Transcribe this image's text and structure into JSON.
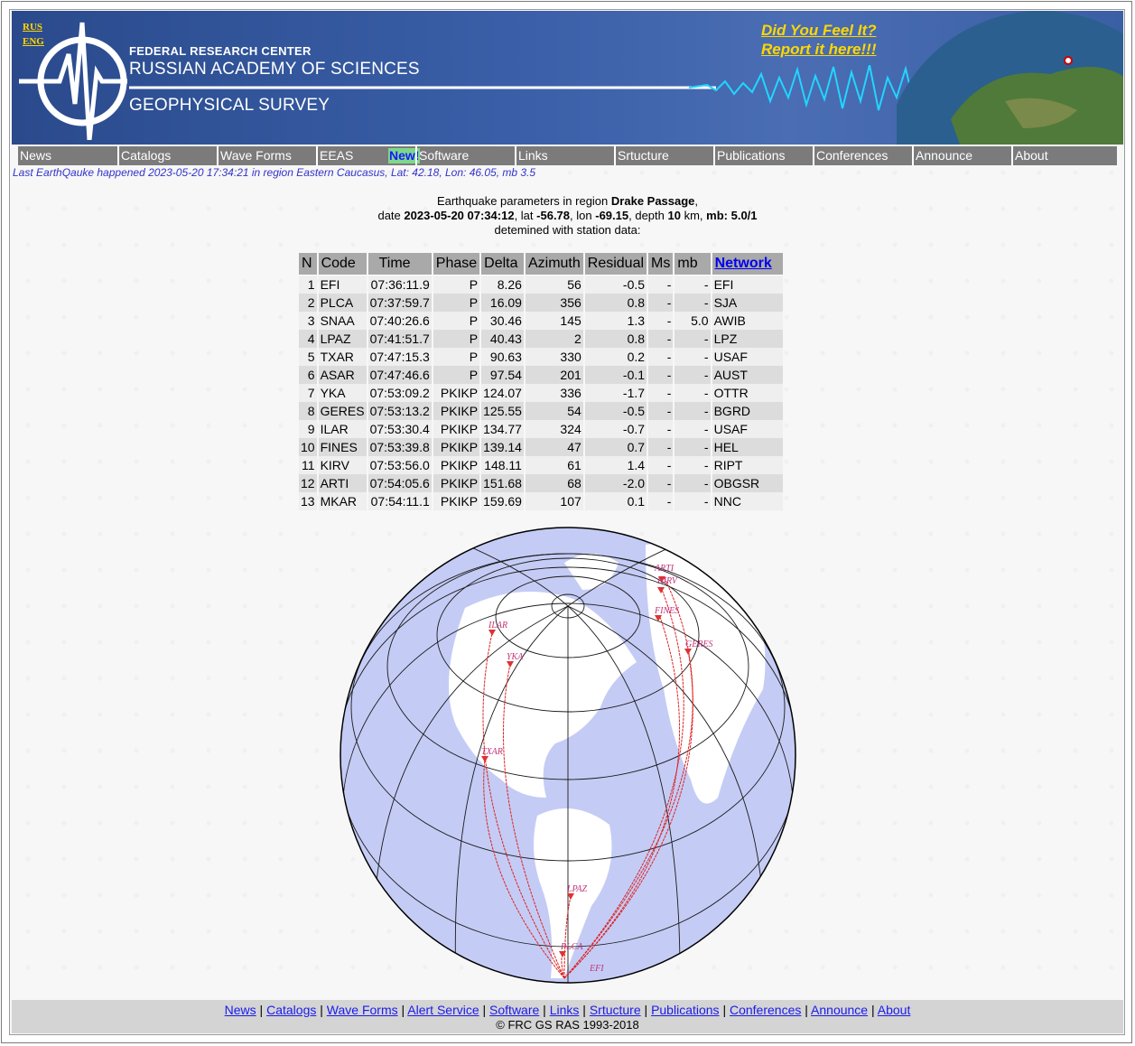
{
  "banner": {
    "lang_rus": "RUS",
    "lang_eng": "ENG",
    "org_line1": "FEDERAL RESEARCH CENTER",
    "org_line2": "RUSSIAN ACADEMY OF SCIENCES",
    "org_line3": "GEOPHYSICAL SURVEY",
    "feel_line1": "Did You Feel It?",
    "feel_line2": "Report it here!!!"
  },
  "nav": {
    "items": [
      "News",
      "Catalogs",
      "Wave Forms",
      "EEAS",
      "Software",
      "Links",
      "Srtucture",
      "Publications",
      "Conferences",
      "Announce",
      "About"
    ],
    "new_badge": "New!"
  },
  "last_quake": "Last EarthQauke happened 2023-05-20 17:34:21 in region Eastern Caucasus, Lat: 42.18, Lon: 46.05, mb 3.5",
  "event": {
    "intro": "Earthquake parameters in region",
    "region": "Drake Passage",
    "date_label": "date",
    "datetime": "2023-05-20 07:34:12",
    "lat_label": ", lat",
    "lat": "-56.78",
    "lon_label": ", lon",
    "lon": "-69.15",
    "depth_label": ", depth",
    "depth": "10",
    "depth_unit": "km,",
    "mb_label": "mb: 5.0/1",
    "determined": "detemined with station data:"
  },
  "table": {
    "headers": [
      "N",
      "Code",
      "Time",
      "Phase",
      "Delta",
      "Azimuth",
      "Residual",
      "Ms",
      "mb",
      "Network"
    ],
    "rows": [
      [
        "1",
        "EFI",
        "07:36:11.9",
        "P",
        "8.26",
        "56",
        "-0.5",
        "-",
        "-",
        "EFI"
      ],
      [
        "2",
        "PLCA",
        "07:37:59.7",
        "P",
        "16.09",
        "356",
        "0.8",
        "-",
        "-",
        "SJA"
      ],
      [
        "3",
        "SNAA",
        "07:40:26.6",
        "P",
        "30.46",
        "145",
        "1.3",
        "-",
        "5.0",
        "AWIB"
      ],
      [
        "4",
        "LPAZ",
        "07:41:51.7",
        "P",
        "40.43",
        "2",
        "0.8",
        "-",
        "-",
        "LPZ"
      ],
      [
        "5",
        "TXAR",
        "07:47:15.3",
        "P",
        "90.63",
        "330",
        "0.2",
        "-",
        "-",
        "USAF"
      ],
      [
        "6",
        "ASAR",
        "07:47:46.6",
        "P",
        "97.54",
        "201",
        "-0.1",
        "-",
        "-",
        "AUST"
      ],
      [
        "7",
        "YKA",
        "07:53:09.2",
        "PKIKP",
        "124.07",
        "336",
        "-1.7",
        "-",
        "-",
        "OTTR"
      ],
      [
        "8",
        "GERES",
        "07:53:13.2",
        "PKIKP",
        "125.55",
        "54",
        "-0.5",
        "-",
        "-",
        "BGRD"
      ],
      [
        "9",
        "ILAR",
        "07:53:30.4",
        "PKIKP",
        "134.77",
        "324",
        "-0.7",
        "-",
        "-",
        "USAF"
      ],
      [
        "10",
        "FINES",
        "07:53:39.8",
        "PKIKP",
        "139.14",
        "47",
        "0.7",
        "-",
        "-",
        "HEL"
      ],
      [
        "11",
        "KIRV",
        "07:53:56.0",
        "PKIKP",
        "148.11",
        "61",
        "1.4",
        "-",
        "-",
        "RIPT"
      ],
      [
        "12",
        "ARTI",
        "07:54:05.6",
        "PKIKP",
        "151.68",
        "68",
        "-2.0",
        "-",
        "-",
        "OBGSR"
      ],
      [
        "13",
        "MKAR",
        "07:54:11.1",
        "PKIKP",
        "159.69",
        "107",
        "0.1",
        "-",
        "-",
        "NNC"
      ]
    ]
  },
  "map": {
    "station_labels": [
      "ARTI",
      "KIRV",
      "FINES",
      "GERES",
      "ILAR",
      "YKA",
      "TXAR",
      "LPAZ",
      "PLCA",
      "EFI"
    ],
    "ocean_color": "#c4ccf5",
    "land_color": "#ffffff",
    "path_color": "#dd2222"
  },
  "footer": {
    "links": [
      "News",
      "Catalogs",
      "Wave Forms",
      "Alert Service",
      "Software",
      "Links",
      "Srtucture",
      "Publications",
      "Conferences",
      "Announce",
      "About"
    ],
    "copyright": "© FRC GS RAS 1993-2018"
  }
}
